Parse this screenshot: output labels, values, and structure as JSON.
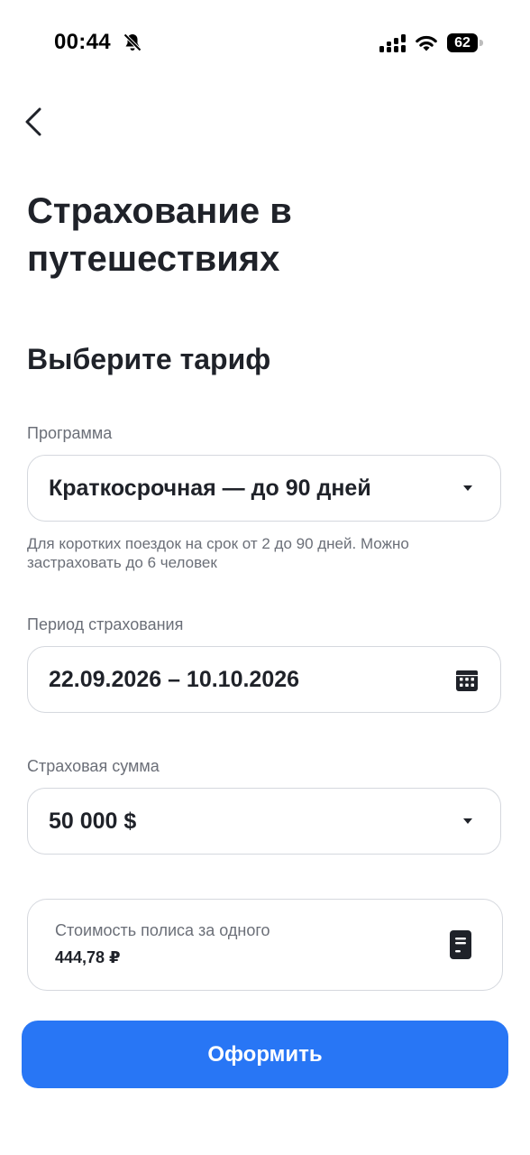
{
  "status_bar": {
    "time": "00:44",
    "battery": "62"
  },
  "header": {
    "title": "Страхование в путешествиях"
  },
  "form": {
    "section_title": "Выберите тариф",
    "program": {
      "label": "Программа",
      "value": "Краткосрочная — до 90 дней",
      "hint": "Для коротких поездок на срок от 2 до 90 дней. Можно застраховать до 6 человек"
    },
    "period": {
      "label": "Период страхования",
      "value": "22.09.2026 – 10.10.2026"
    },
    "sum": {
      "label": "Страховая сумма",
      "value": "50 000 $"
    },
    "cost": {
      "label": "Стоимость полиса за одного",
      "value": "444,78 ₽"
    }
  },
  "actions": {
    "submit_label": "Оформить"
  },
  "icons": {
    "back": "chevron-left-icon",
    "bell_off": "bell-off-icon",
    "signal": "signal-icon",
    "wifi": "wifi-icon",
    "dropdown": "caret-down-icon",
    "calendar": "calendar-icon",
    "receipt": "receipt-icon"
  },
  "colors": {
    "accent": "#2876f5",
    "text": "#1f2229",
    "muted": "#6b6f78",
    "border": "#d5d8de"
  }
}
